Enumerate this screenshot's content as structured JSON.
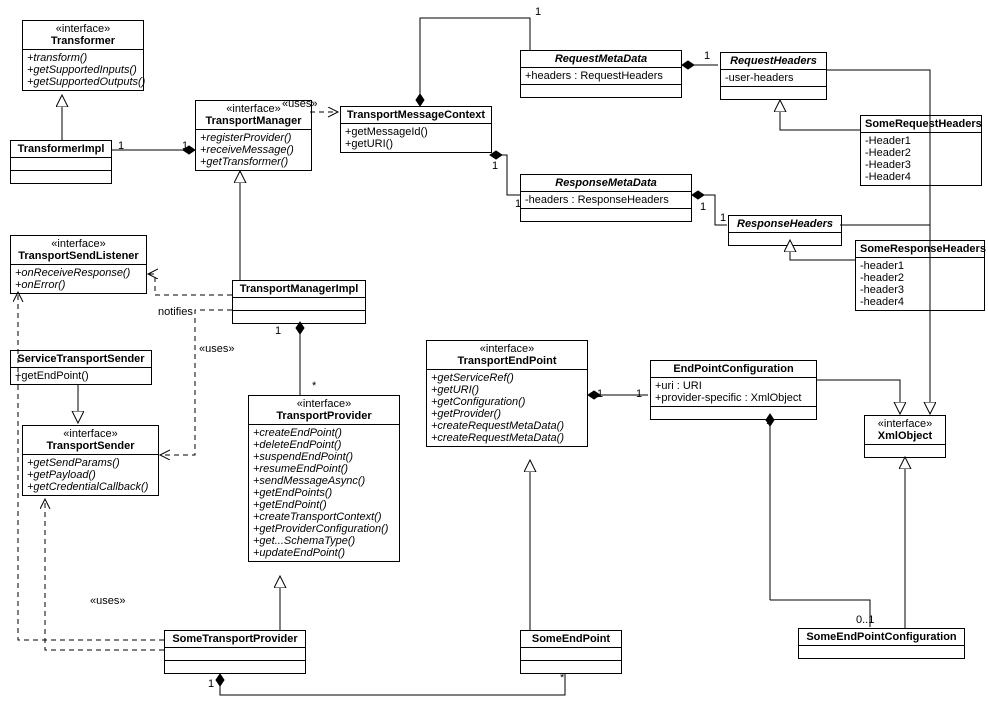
{
  "classes": {
    "transformer": {
      "stereotype": "«interface»",
      "name": "Transformer",
      "ops": [
        "+transform()",
        "+getSupportedInputs()",
        "+getSupportedOutputs()"
      ]
    },
    "transformerImpl": {
      "name": "TransformerImpl"
    },
    "transportManager": {
      "stereotype": "«interface»",
      "name": "TransportManager",
      "ops": [
        "+registerProvider()",
        "+receiveMessage()",
        "+getTransformer()"
      ]
    },
    "transportMessageContext": {
      "name": "TransportMessageContext",
      "ops": [
        "+getMessageId()",
        "+getURI()"
      ]
    },
    "requestMetaData": {
      "name": "RequestMetaData",
      "attrs": [
        "+headers : RequestHeaders"
      ]
    },
    "requestHeaders": {
      "name": "RequestHeaders",
      "attrs": [
        "-user-headers"
      ]
    },
    "someRequestHeaders": {
      "name": "SomeRequestHeaders",
      "attrs": [
        "-Header1",
        "-Header2",
        "-Header3",
        "-Header4"
      ]
    },
    "responseMetaData": {
      "name": "ResponseMetaData",
      "attrs": [
        "-headers : ResponseHeaders"
      ]
    },
    "responseHeaders": {
      "name": "ResponseHeaders"
    },
    "someResponseHeaders": {
      "name": "SomeResponseHeaders",
      "attrs": [
        "-header1",
        "-header2",
        "-header3",
        "-header4"
      ]
    },
    "transportSendListener": {
      "stereotype": "«interface»",
      "name": "TransportSendListener",
      "ops": [
        "+onReceiveResponse()",
        "+onError()"
      ]
    },
    "transportManagerImpl": {
      "name": "TransportManagerImpl"
    },
    "serviceTransportSender": {
      "name": "ServiceTransportSender",
      "ops": [
        "+getEndPoint()"
      ]
    },
    "transportSender": {
      "stereotype": "«interface»",
      "name": "TransportSender",
      "ops": [
        "+getSendParams()",
        "+getPayload()",
        "+getCredentialCallback()"
      ]
    },
    "transportProvider": {
      "stereotype": "«interface»",
      "name": "TransportProvider",
      "ops": [
        "+createEndPoint()",
        "+deleteEndPoint()",
        "+suspendEndPoint()",
        "+resumeEndPoint()",
        "+sendMessageAsync()",
        "+getEndPoints()",
        "+getEndPoint()",
        "+createTransportContext()",
        "+getProviderConfiguration()",
        "+get...SchemaType()",
        "+updateEndPoint()"
      ]
    },
    "transportEndPoint": {
      "stereotype": "«interface»",
      "name": "TransportEndPoint",
      "ops": [
        "+getServiceRef()",
        "+getURI()",
        "+getConfiguration()",
        "+getProvider()",
        "+createRequestMetaData()",
        "+createRequestMetaData()"
      ]
    },
    "endPointConfiguration": {
      "name": "EndPointConfiguration",
      "attrs": [
        "+uri : URI",
        "+provider-specific : XmlObject"
      ]
    },
    "xmlObject": {
      "stereotype": "«interface»",
      "name": "XmlObject"
    },
    "someTransportProvider": {
      "name": "SomeTransportProvider"
    },
    "someEndPoint": {
      "name": "SomeEndPoint"
    },
    "someEndPointConfiguration": {
      "name": "SomeEndPointConfiguration"
    }
  },
  "labels": {
    "uses1": "«uses»",
    "uses2": "«uses»",
    "uses3": "«uses»",
    "notifies": "notifies",
    "one": "1",
    "star": "*",
    "zeroOne": "0..1"
  }
}
